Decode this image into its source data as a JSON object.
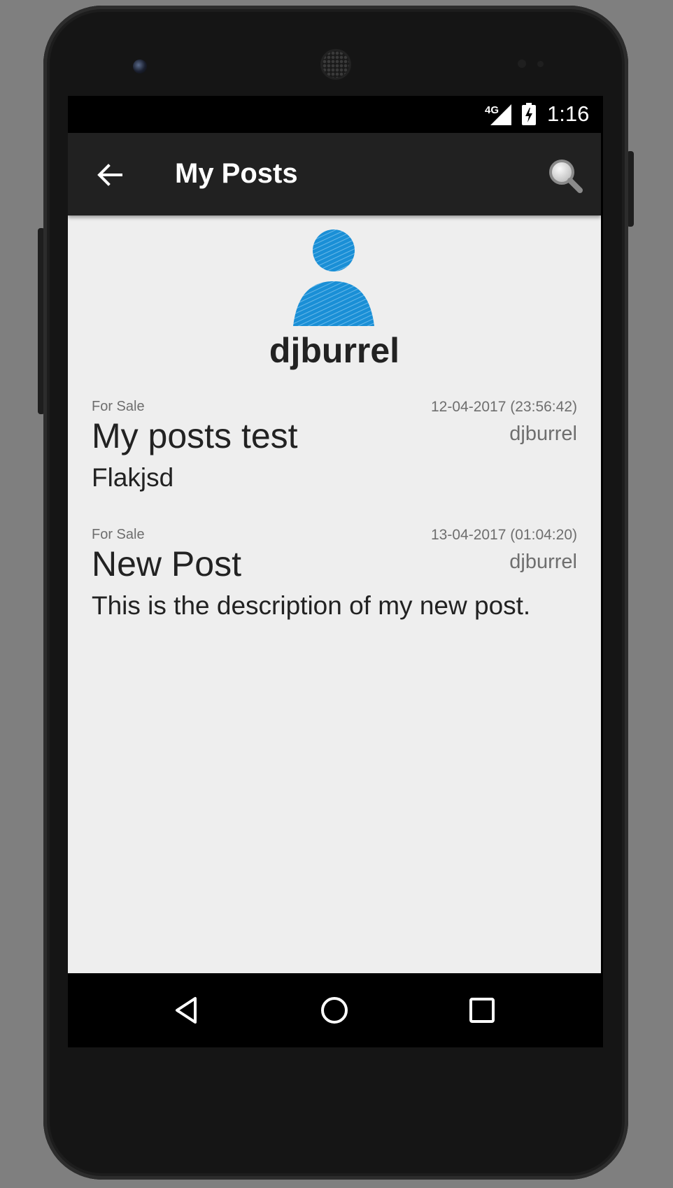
{
  "status_bar": {
    "network": "4G",
    "time": "1:16"
  },
  "toolbar": {
    "title": "My Posts",
    "back_icon": "arrow-back-icon",
    "search_icon": "search-icon"
  },
  "profile": {
    "avatar_icon": "user-avatar-icon",
    "avatar_color": "#1a8fd6",
    "username": "djburrel"
  },
  "posts": [
    {
      "category": "For Sale",
      "date": "12-04-2017 (23:56:42)",
      "title": "My posts test",
      "author": "djburrel",
      "description": "Flakjsd"
    },
    {
      "category": "For Sale",
      "date": "13-04-2017 (01:04:20)",
      "title": "New Post",
      "author": "djburrel",
      "description": "This is the description of my new post."
    }
  ],
  "nav_bar": {
    "back_icon": "triangle-back-icon",
    "home_icon": "circle-home-icon",
    "recents_icon": "square-recents-icon"
  }
}
